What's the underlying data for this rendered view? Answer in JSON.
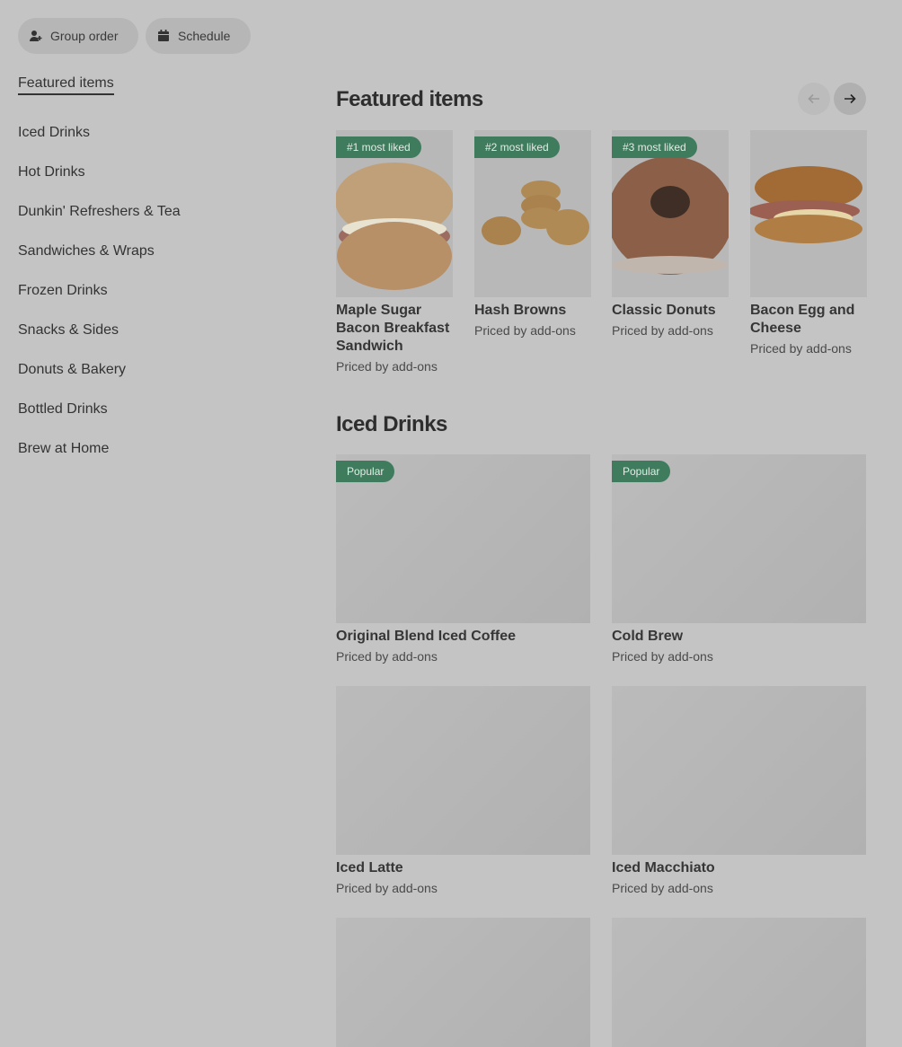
{
  "top_buttons": {
    "group_order": "Group order",
    "schedule": "Schedule"
  },
  "nav": {
    "items": [
      "Featured items",
      "Iced Drinks",
      "Hot Drinks",
      "Dunkin' Refreshers & Tea",
      "Sandwiches & Wraps",
      "Frozen Drinks",
      "Snacks & Sides",
      "Donuts & Bakery",
      "Bottled Drinks",
      "Brew at Home"
    ]
  },
  "featured": {
    "title": "Featured items",
    "cards": [
      {
        "badge": "#1 most liked",
        "name": "Maple Sugar Bacon Breakfast Sandwich",
        "price": "Priced by add-ons"
      },
      {
        "badge": "#2 most liked",
        "name": "Hash Browns",
        "price": "Priced by add-ons"
      },
      {
        "badge": "#3 most liked",
        "name": "Classic Donuts",
        "price": "Priced by add-ons"
      },
      {
        "badge": "",
        "name": "Bacon Egg and Cheese",
        "price": "Priced by add-ons"
      }
    ]
  },
  "iced": {
    "title": "Iced Drinks",
    "cards": [
      {
        "badge": "Popular",
        "name": "Original Blend Iced Coffee",
        "price": "Priced by add-ons"
      },
      {
        "badge": "Popular",
        "name": "Cold Brew",
        "price": "Priced by add-ons"
      },
      {
        "badge": "",
        "name": "Iced Latte",
        "price": "Priced by add-ons"
      },
      {
        "badge": "",
        "name": "Iced Macchiato",
        "price": "Priced by add-ons"
      }
    ]
  },
  "colors": {
    "overlay_bg": "#c4c4c4",
    "badge_green": "#3e7c5d"
  },
  "icons": {
    "group_order": "person-add-icon",
    "schedule": "calendar-icon",
    "prev": "arrow-left-icon",
    "next": "arrow-right-icon"
  }
}
